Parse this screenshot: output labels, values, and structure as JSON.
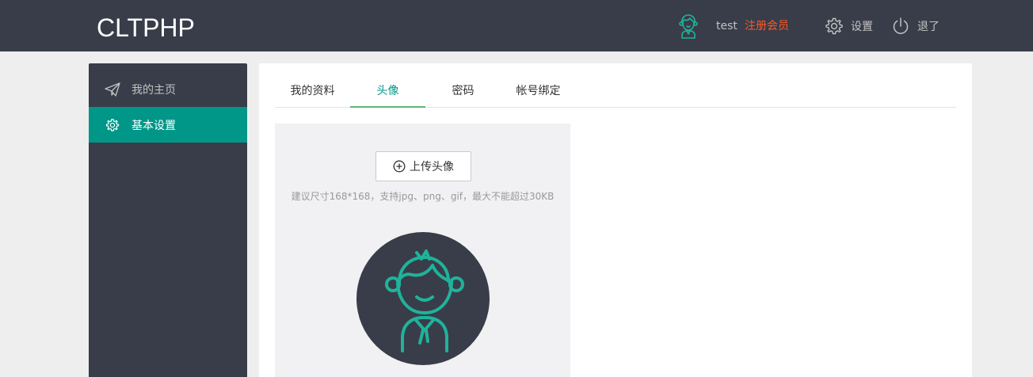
{
  "header": {
    "logo": "CLTPHP",
    "username": "test",
    "register_label": "注册会员",
    "settings_label": "设置",
    "logout_label": "退了"
  },
  "sidebar": {
    "items": [
      {
        "label": "我的主页",
        "icon": "paper-plane-icon"
      },
      {
        "label": "基本设置",
        "icon": "gear-icon"
      }
    ]
  },
  "tabs": [
    {
      "label": "我的资料"
    },
    {
      "label": "头像"
    },
    {
      "label": "密码"
    },
    {
      "label": "帐号绑定"
    }
  ],
  "upload": {
    "button_label": "上传头像",
    "hint": "建议尺寸168*168，支持jpg、png、gif，最大不能超过30KB"
  },
  "colors": {
    "header_bg": "#393d49",
    "accent": "#009688",
    "accent_line": "#5fb878",
    "register": "#ff5722",
    "avatar_line": "#1fb39b"
  }
}
